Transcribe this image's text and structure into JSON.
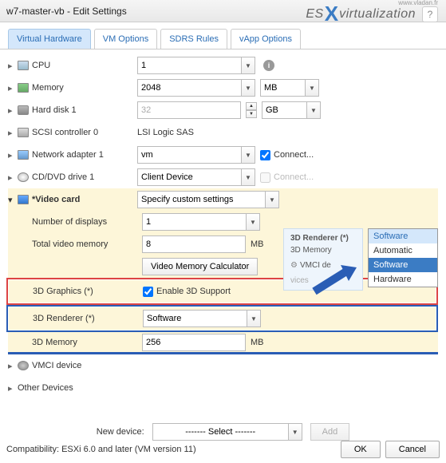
{
  "window": {
    "title": "w7-master-vb - Edit Settings"
  },
  "logo": {
    "part1": "ES",
    "x": "X",
    "part2": "virtualization",
    "sub": "www.vladan.fr"
  },
  "tabs": [
    {
      "label": "Virtual Hardware",
      "active": true
    },
    {
      "label": "VM Options",
      "active": false
    },
    {
      "label": "SDRS Rules",
      "active": false
    },
    {
      "label": "vApp Options",
      "active": false
    }
  ],
  "hardware": {
    "cpu": {
      "label": "CPU",
      "value": "1"
    },
    "memory": {
      "label": "Memory",
      "value": "2048",
      "unit": "MB"
    },
    "harddisk": {
      "label": "Hard disk 1",
      "value": "32",
      "unit": "GB"
    },
    "scsi": {
      "label": "SCSI controller 0",
      "value": "LSI Logic SAS"
    },
    "network": {
      "label": "Network adapter 1",
      "value": "vm",
      "connect": "Connect..."
    },
    "cddvd": {
      "label": "CD/DVD drive 1",
      "value": "Client Device",
      "connect": "Connect..."
    },
    "video": {
      "label": "*Video card",
      "value": "Specify custom settings",
      "displays_label": "Number of displays",
      "displays_value": "1",
      "totalmem_label": "Total video memory",
      "totalmem_value": "8",
      "totalmem_unit": "MB",
      "calc_button": "Video Memory Calculator",
      "graphics_label": "3D Graphics (*)",
      "graphics_check": "Enable 3D Support",
      "renderer_label": "3D Renderer (*)",
      "renderer_value": "Software",
      "mem3d_label": "3D Memory",
      "mem3d_value": "256",
      "mem3d_unit": "MB"
    },
    "vmci": {
      "label": "VMCI device"
    },
    "other": {
      "label": "Other Devices"
    }
  },
  "tooltip": {
    "header": "3D Renderer (*)",
    "line1": "3D Memory",
    "line2": "VMCI de",
    "line3": "vices"
  },
  "renderer_options": [
    "Software",
    "Automatic",
    "Software",
    "Hardware"
  ],
  "new_device": {
    "label": "New device:",
    "select": "------- Select -------",
    "add": "Add"
  },
  "footer": {
    "compat": "Compatibility: ESXi 6.0 and later (VM version 11)",
    "ok": "OK",
    "cancel": "Cancel"
  }
}
